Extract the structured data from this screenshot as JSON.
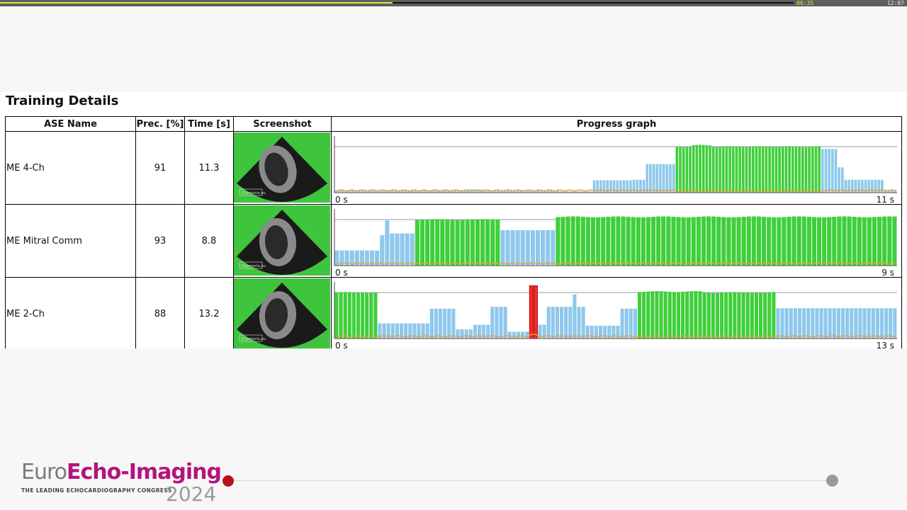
{
  "player": {
    "elapsed": "06:35",
    "total": "12:07",
    "progress": 0.495
  },
  "section_title": "Training Details",
  "table": {
    "headers": [
      "ASE Name",
      "Prec. [%]",
      "Time [s]",
      "Screenshot",
      "Progress graph"
    ],
    "rows": [
      {
        "name": "ME 4-Ch",
        "precision": "91",
        "time": "11.3",
        "axis_start": "0 s",
        "axis_end": "11 s",
        "screenshot_caption": "3Dprojects.eu"
      },
      {
        "name": "ME Mitral Comm",
        "precision": "93",
        "time": "8.8",
        "axis_start": "0 s",
        "axis_end": "9 s",
        "screenshot_caption": "3Dprojects.eu"
      },
      {
        "name": "ME 2-Ch",
        "precision": "88",
        "time": "13.2",
        "axis_start": "0 s",
        "axis_end": "13 s",
        "screenshot_caption": "3Dprojects.eu"
      }
    ]
  },
  "colors": {
    "green": "#3fcf3b",
    "blue": "#8ec8ec",
    "red": "#ee2b2b",
    "orange": "#f0a030",
    "thumb_bg": "#3fc43d"
  },
  "chart_data": [
    {
      "type": "bar",
      "series_colors": "green=in target view, blue=not yet, orange=line",
      "x": {
        "start_label": "0 s",
        "end_label": "11 s"
      },
      "bar_count": 132,
      "segments": [
        {
          "from": 0,
          "to": 40,
          "value": 0.05,
          "color": "blue"
        },
        {
          "from": 40,
          "to": 45,
          "value": 0.07,
          "color": "blue"
        },
        {
          "from": 45,
          "to": 68,
          "value": 0.05,
          "color": "blue"
        },
        {
          "from": 68,
          "to": 78,
          "value": 0.03,
          "color": "blue"
        },
        {
          "from": 78,
          "to": 90,
          "value": 0.27,
          "color": "blue"
        },
        {
          "from": 90,
          "to": 94,
          "value": 0.28,
          "color": "blue"
        },
        {
          "from": 94,
          "to": 103,
          "value": 0.62,
          "color": "blue"
        },
        {
          "from": 103,
          "to": 108,
          "value": 1.0,
          "color": "green"
        },
        {
          "from": 108,
          "to": 114,
          "value": 1.03,
          "color": "green"
        },
        {
          "from": 114,
          "to": 147,
          "value": 1.0,
          "color": "green"
        },
        {
          "from": 147,
          "to": 152,
          "value": 0.95,
          "color": "blue"
        },
        {
          "from": 152,
          "to": 154,
          "value": 0.55,
          "color": "blue"
        },
        {
          "from": 154,
          "to": 166,
          "value": 0.28,
          "color": "blue"
        },
        {
          "from": 166,
          "to": 170,
          "value": 0.06,
          "color": "blue"
        }
      ]
    },
    {
      "type": "bar",
      "x": {
        "start_label": "0 s",
        "end_label": "9 s"
      },
      "segments": [
        {
          "from": 0,
          "to": 9,
          "value": 0.33,
          "color": "blue"
        },
        {
          "from": 9,
          "to": 10,
          "value": 0.66,
          "color": "blue"
        },
        {
          "from": 10,
          "to": 11,
          "value": 0.98,
          "color": "blue"
        },
        {
          "from": 11,
          "to": 16,
          "value": 0.7,
          "color": "blue"
        },
        {
          "from": 16,
          "to": 33,
          "value": 1.0,
          "color": "green"
        },
        {
          "from": 33,
          "to": 44,
          "value": 0.77,
          "color": "blue"
        },
        {
          "from": 44,
          "to": 112,
          "value": 1.06,
          "color": "green"
        }
      ]
    },
    {
      "type": "bar",
      "x": {
        "start_label": "0 s",
        "end_label": "13 s"
      },
      "segments": [
        {
          "from": 0,
          "to": 10,
          "value": 1.0,
          "color": "green"
        },
        {
          "from": 10,
          "to": 15,
          "value": 0.33,
          "color": "blue"
        },
        {
          "from": 15,
          "to": 22,
          "value": 0.33,
          "color": "blue"
        },
        {
          "from": 22,
          "to": 28,
          "value": 0.65,
          "color": "blue"
        },
        {
          "from": 28,
          "to": 32,
          "value": 0.2,
          "color": "blue"
        },
        {
          "from": 32,
          "to": 36,
          "value": 0.3,
          "color": "blue"
        },
        {
          "from": 36,
          "to": 40,
          "value": 0.69,
          "color": "blue"
        },
        {
          "from": 40,
          "to": 45,
          "value": 0.15,
          "color": "blue"
        },
        {
          "from": 45,
          "to": 47,
          "value": 1.15,
          "color": "red"
        },
        {
          "from": 47,
          "to": 49,
          "value": 0.3,
          "color": "blue"
        },
        {
          "from": 49,
          "to": 55,
          "value": 0.69,
          "color": "blue"
        },
        {
          "from": 55,
          "to": 56,
          "value": 0.96,
          "color": "blue"
        },
        {
          "from": 56,
          "to": 58,
          "value": 0.69,
          "color": "blue"
        },
        {
          "from": 58,
          "to": 66,
          "value": 0.28,
          "color": "blue"
        },
        {
          "from": 66,
          "to": 70,
          "value": 0.65,
          "color": "blue"
        },
        {
          "from": 70,
          "to": 85,
          "value": 1.02,
          "color": "green"
        },
        {
          "from": 85,
          "to": 102,
          "value": 1.0,
          "color": "green"
        },
        {
          "from": 102,
          "to": 130,
          "value": 0.66,
          "color": "blue"
        }
      ]
    }
  ],
  "footer": {
    "logo_euro": "Euro",
    "logo_echo": "Echo-Imaging",
    "logo_tagline": "THE LEADING ECHOCARDIOGRAPHY CONGRESS",
    "logo_year": "2024"
  }
}
